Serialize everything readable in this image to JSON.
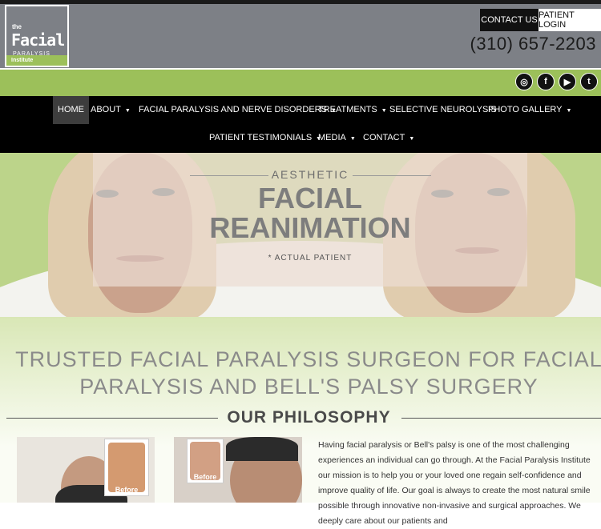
{
  "header": {
    "logo": {
      "the": "the",
      "facial": "Facial",
      "paralysis": "PARALYSIS",
      "institute": "Institute"
    },
    "contact_label": "CONTACT US",
    "login_label": "PATIENT LOGIN",
    "phone": "(310) 657-2203"
  },
  "social": [
    {
      "icon": "instagram-icon",
      "glyph": "◎"
    },
    {
      "icon": "facebook-icon",
      "glyph": "f"
    },
    {
      "icon": "youtube-icon",
      "glyph": "▶"
    },
    {
      "icon": "twitter-icon",
      "glyph": "t"
    }
  ],
  "nav": {
    "row1": [
      {
        "label": "HOME",
        "dropdown": false,
        "active": true
      },
      {
        "label": "ABOUT",
        "dropdown": true
      },
      {
        "label": "FACIAL PARALYSIS AND NERVE DISORDERS",
        "dropdown": true
      },
      {
        "label": "TREATMENTS",
        "dropdown": true
      },
      {
        "label": "SELECTIVE NEUROLYSIS",
        "dropdown": false
      },
      {
        "label": "PHOTO GALLERY",
        "dropdown": true
      }
    ],
    "row2": [
      {
        "label": "PATIENT TESTIMONIALS",
        "dropdown": true
      },
      {
        "label": "MEDIA",
        "dropdown": true
      },
      {
        "label": "CONTACT",
        "dropdown": true
      }
    ],
    "caret": "▼"
  },
  "hero": {
    "eyebrow": "AESTHETIC",
    "title_line1": "FACIAL",
    "title_line2": "REANIMATION",
    "caption": "* ACTUAL PATIENT"
  },
  "main": {
    "heading_line1": "TRUSTED FACIAL PARALYSIS SURGEON FOR FACIAL",
    "heading_line2": "PARALYSIS AND BELL'S PALSY SURGERY",
    "philosophy": "OUR PHILOSOPHY",
    "before_label": "Before",
    "paragraph": "Having facial paralysis or Bell's palsy is one of the most challenging experiences an individual can go through. At the Facial Paralysis Institute our mission is to help you or your loved one regain self-confidence and improve quality of life. Our goal is always to create the most natural smile possible through innovative non-invasive and surgical approaches. We deeply care about our patients and"
  },
  "colors": {
    "gray": "#7d8086",
    "green": "#9cc05a",
    "nav": "#000000"
  }
}
